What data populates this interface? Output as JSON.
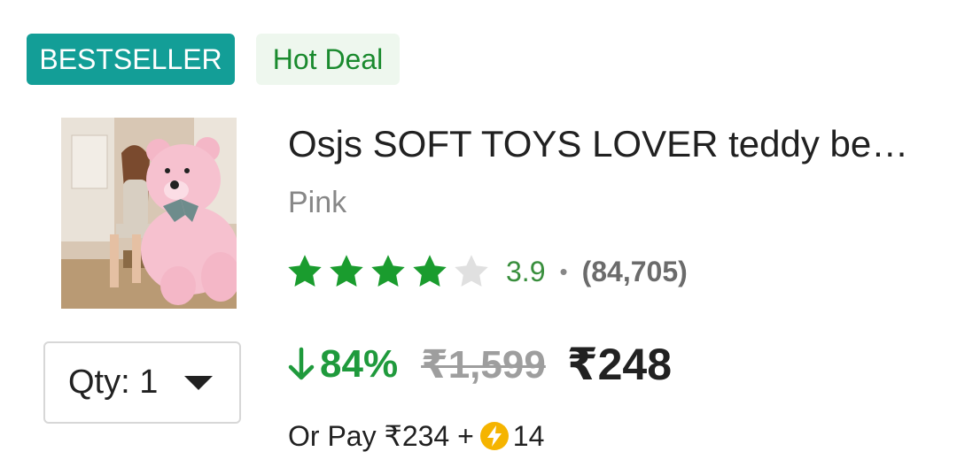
{
  "badges": {
    "bestseller": "BESTSELLER",
    "hot_deal": "Hot Deal"
  },
  "product": {
    "title": "Osjs SOFT TOYS LOVER teddy be…",
    "variant": "Pink",
    "image_icon": "teddy-bear-product-image"
  },
  "rating": {
    "value": "3.9",
    "separator": "•",
    "count": "(84,705)",
    "stars_filled": 4,
    "stars_total": 5
  },
  "quantity": {
    "label": "Qty: 1"
  },
  "pricing": {
    "discount": "84%",
    "mrp": "₹1,599",
    "price": "₹248"
  },
  "pay_option": {
    "prefix": "Or Pay ₹234 +",
    "coins": "14",
    "coin_icon": "lightning-coin-icon"
  },
  "colors": {
    "badge_teal": "#139e97",
    "hot_deal_green": "#1a8a2e",
    "star_green": "#1a9c2e",
    "discount_green": "#1f9a3c",
    "coin_yellow": "#f5b400"
  }
}
